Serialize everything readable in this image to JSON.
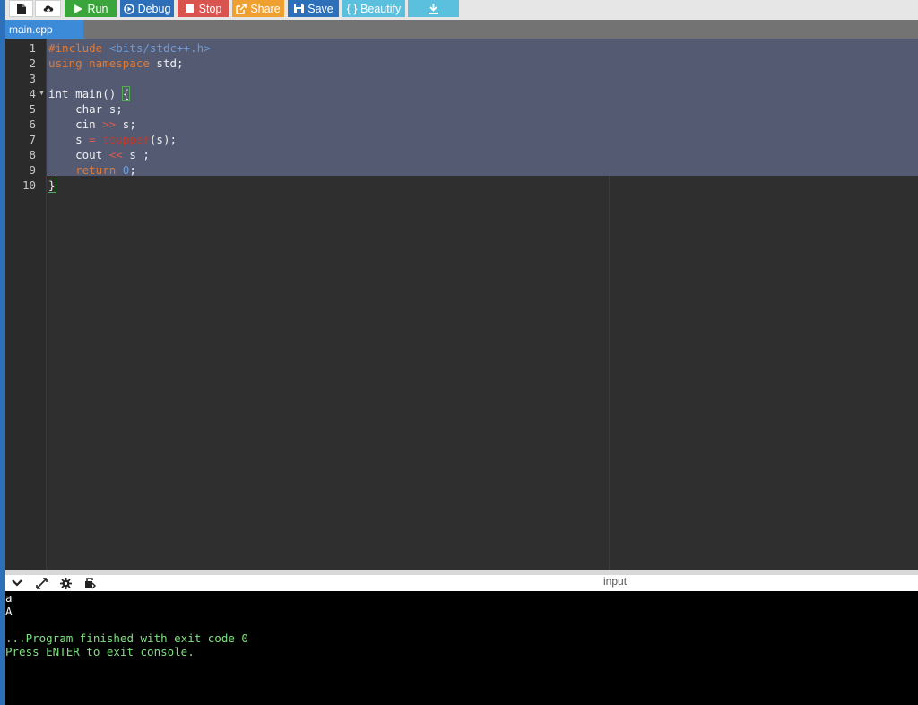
{
  "toolbar": {
    "run_label": "Run",
    "debug_label": "Debug",
    "stop_label": "Stop",
    "share_label": "Share",
    "save_label": "Save",
    "beautify_label": "{ } Beautify"
  },
  "tabs": [
    {
      "label": "main.cpp",
      "active": true
    }
  ],
  "editor": {
    "line_numbers": [
      "1",
      "2",
      "3",
      "4",
      "5",
      "6",
      "7",
      "8",
      "9",
      "10"
    ]
  },
  "console": {
    "input_label": "input",
    "lines": [
      "a",
      "A",
      "",
      "...Program finished with exit code 0",
      "Press ENTER to exit console."
    ]
  },
  "colors": {
    "accent": "#3b8bd9",
    "run": "#3aa53a",
    "debug": "#2d6fb8",
    "stop": "#d9534f",
    "share": "#f0a030",
    "save": "#2d6fb8",
    "beautify": "#5bc0de",
    "download": "#5bc0de",
    "console_text": "#7fe07f"
  },
  "icons": [
    "new-file-icon",
    "upload-icon",
    "play-icon",
    "debug-icon",
    "stop-icon",
    "share-icon",
    "save-icon",
    "download-icon",
    "chevron-down-icon",
    "expand-icon",
    "gear-icon",
    "keyboard-icon"
  ]
}
